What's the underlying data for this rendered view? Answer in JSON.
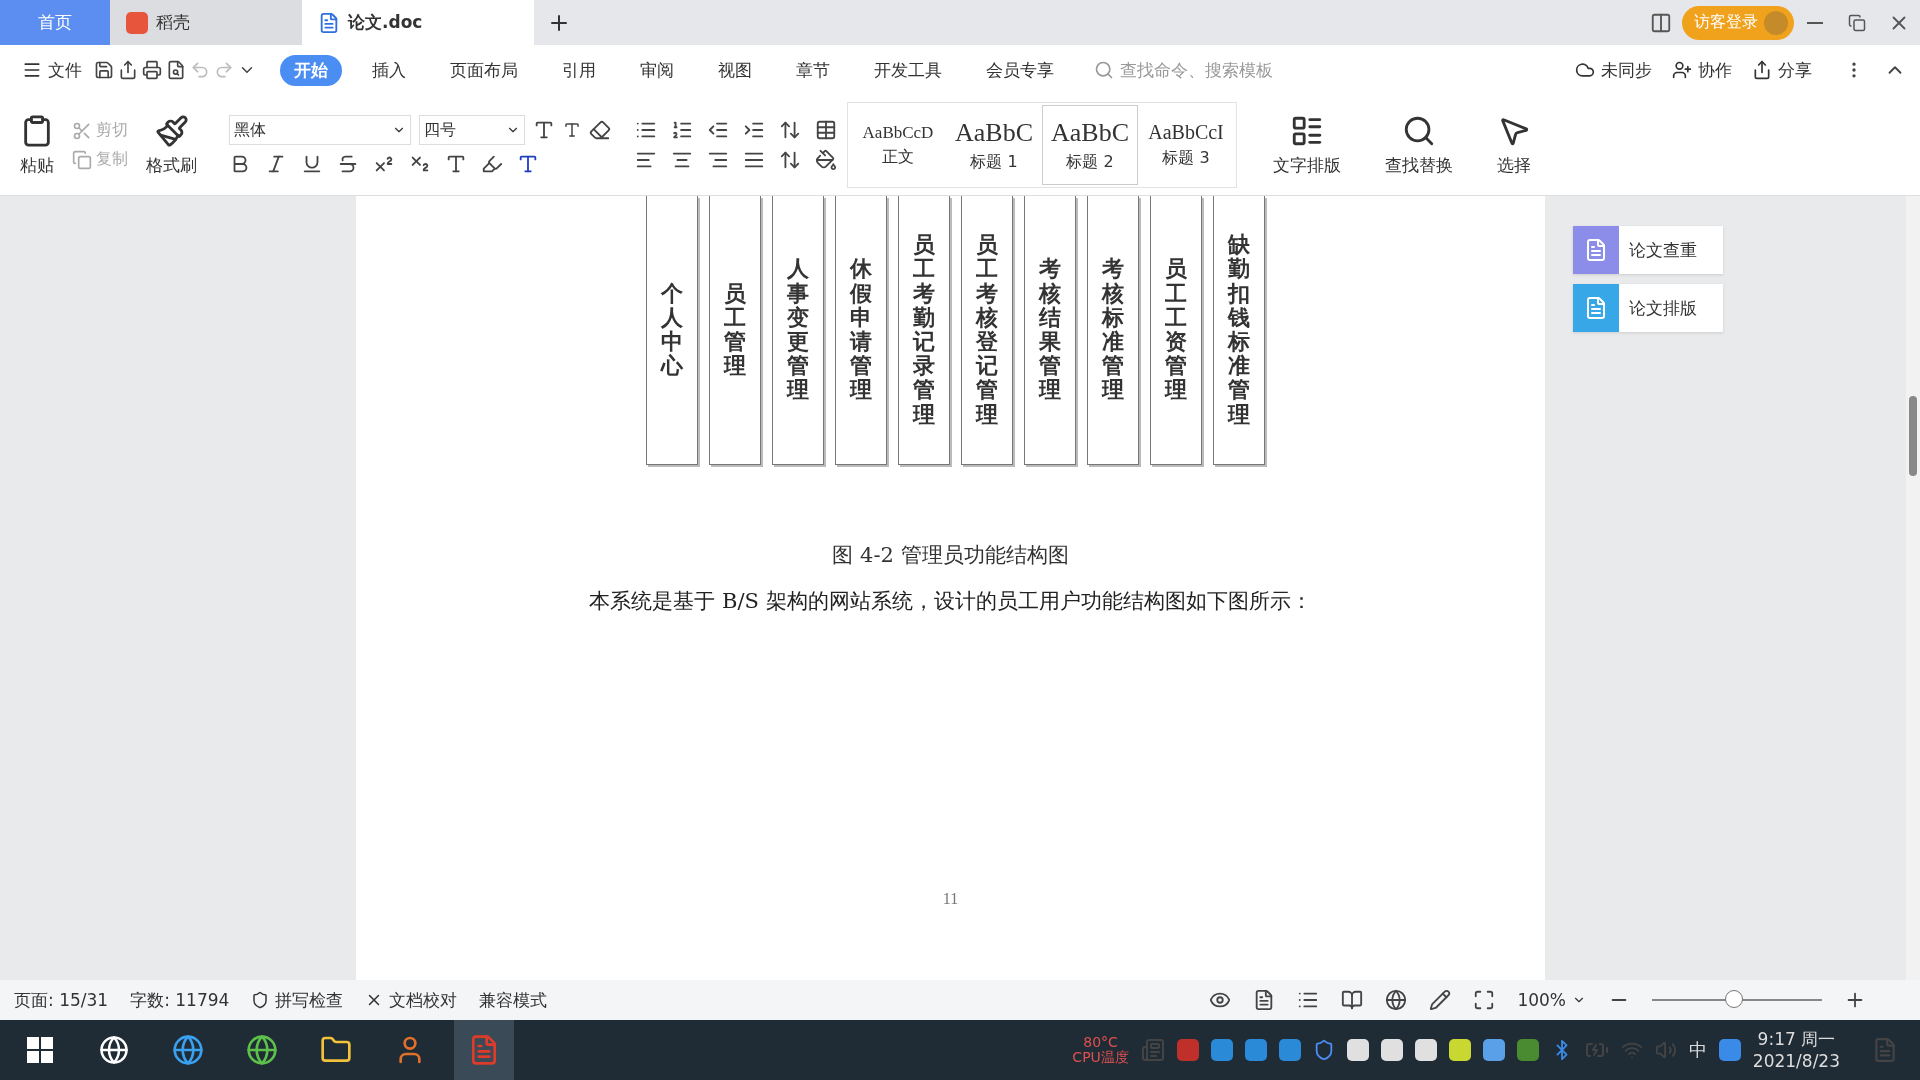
{
  "tabs": [
    {
      "label": "首页",
      "kind": "home",
      "selected": false
    },
    {
      "label": "稻壳",
      "kind": "app",
      "selected": false
    },
    {
      "label": "论文.doc",
      "kind": "doc",
      "selected": true
    }
  ],
  "login": "访客登录",
  "file_menu": "文件",
  "menu_tabs": [
    {
      "label": "开始",
      "selected": true
    },
    {
      "label": "插入",
      "selected": false
    },
    {
      "label": "页面布局",
      "selected": false
    },
    {
      "label": "引用",
      "selected": false
    },
    {
      "label": "审阅",
      "selected": false
    },
    {
      "label": "视图",
      "selected": false
    },
    {
      "label": "章节",
      "selected": false
    },
    {
      "label": "开发工具",
      "selected": false
    },
    {
      "label": "会员专享",
      "selected": false
    }
  ],
  "search": {
    "placeholder": "查找命令、搜索模板"
  },
  "cloud_actions": [
    "未同步",
    "协作",
    "分享"
  ],
  "clipboard": {
    "paste": "粘贴",
    "format_painter": "格式刷",
    "small": [
      {
        "label": "剪切",
        "disabled": true
      },
      {
        "label": "复制",
        "disabled": true
      }
    ]
  },
  "font": {
    "name": "黑体",
    "size": "四号"
  },
  "styles": [
    {
      "preview": "AaBbCcD",
      "label": "正文",
      "selected": false
    },
    {
      "preview": "AaBbC",
      "label": "标题 1",
      "selected": false
    },
    {
      "preview": "AaBbC",
      "label": "标题 2",
      "selected": true
    },
    {
      "preview": "AaBbCcI",
      "label": "标题 3",
      "selected": false
    }
  ],
  "big_tools": [
    "文字排版",
    "查找替换",
    "选择"
  ],
  "diagram": {
    "boxes": [
      "个人中心",
      "员工管理",
      "人事变更管理",
      "休假申请管理",
      "员工考勤记录管理",
      "员工考核登记管理",
      "考核结果管理",
      "考核标准管理",
      "员工工资管理",
      "缺勤扣钱标准管理"
    ]
  },
  "caption": "图 4-2 管理员功能结构图",
  "paragraph": "本系统是基于 B/S 架构的网站系统，设计的员工用户功能结构图如下图所示：",
  "page_number": "11",
  "side_panel": [
    "论文查重",
    "论文排版"
  ],
  "status_bar": {
    "page": "页面: 15/31",
    "words": "字数: 11794",
    "spell": "拼写检查",
    "proof": "文档校对",
    "mode": "兼容模式",
    "zoom": "100%",
    "zoom_slider": {
      "level": 0.48
    }
  },
  "taskbar": {
    "cpu_temp": "80°C",
    "cpu_label": "CPU温度",
    "ime": "中",
    "time": "9:17 周一",
    "date": "2021/8/23"
  }
}
